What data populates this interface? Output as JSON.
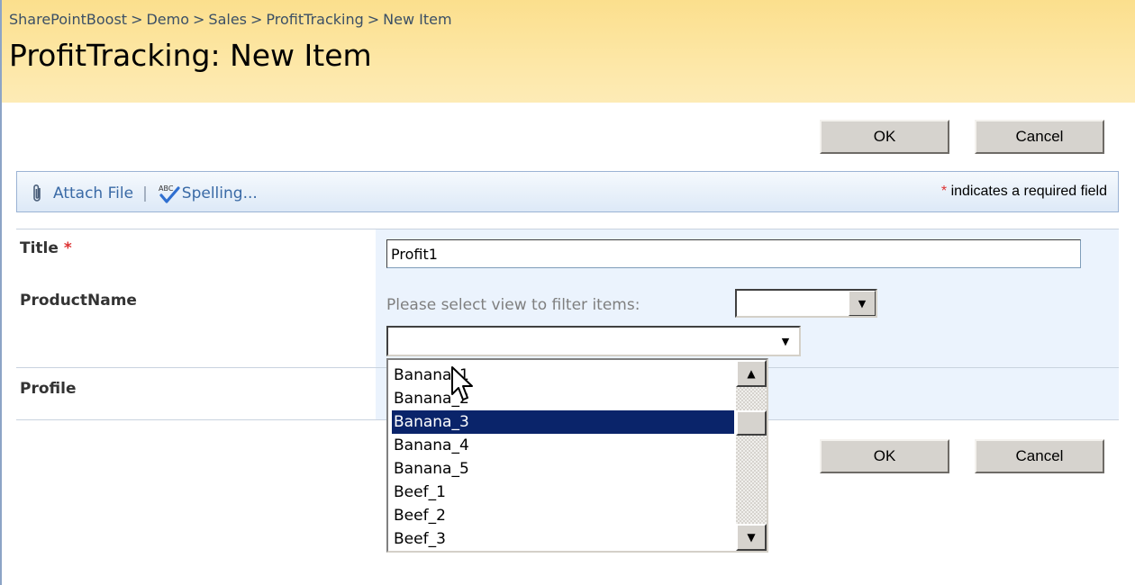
{
  "breadcrumb": {
    "items": [
      "SharePointBoost",
      "Demo",
      "Sales",
      "ProfitTracking",
      "New Item"
    ],
    "separator": ">"
  },
  "page_title": "ProfitTracking: New Item",
  "buttons": {
    "ok_label": "OK",
    "cancel_label": "Cancel"
  },
  "toolbar": {
    "attach_label": "Attach File",
    "divider": "|",
    "spelling_label": "Spelling...",
    "required_star": "*",
    "required_note": "indicates a required field"
  },
  "form": {
    "title": {
      "label": "Title",
      "required_mark": "*",
      "value": "Profit1"
    },
    "product_name": {
      "label": "ProductName",
      "filter_prompt": "Please select view to filter items:",
      "filter_value": "",
      "selected_value": "",
      "options": [
        "Banana_1",
        "Banana_2",
        "Banana_3",
        "Banana_4",
        "Banana_5",
        "Beef_1",
        "Beef_2",
        "Beef_3"
      ],
      "highlighted": "Banana_3"
    },
    "profile": {
      "label": "Profile"
    }
  },
  "colors": {
    "title_band": "#fbdf8d",
    "toolbar_link": "#3a6aa6",
    "value_band": "#ebf3fd",
    "list_highlight": "#0a246a",
    "required": "#dd3333"
  },
  "icons": {
    "attach": "paperclip-icon",
    "spelling": "spellcheck-icon",
    "dropdown": "chevron-down-icon",
    "cursor": "mouse-pointer-icon"
  }
}
